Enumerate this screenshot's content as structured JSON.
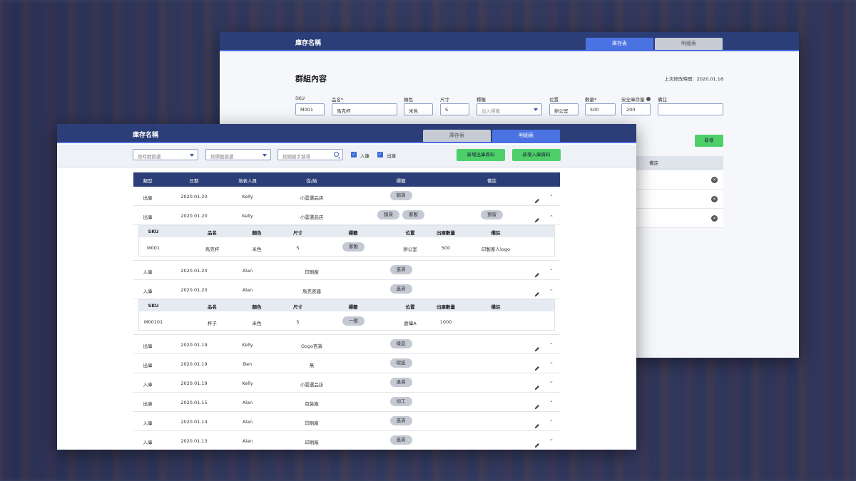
{
  "back_window": {
    "title": "庫存名稱",
    "tabs": [
      {
        "label": "庫存表",
        "active": true
      },
      {
        "label": "明細表",
        "active": false
      }
    ],
    "group_title": "群組內容",
    "last_modified": "上次修改時間：2020.01.18",
    "fields": {
      "sku": {
        "label": "SKU",
        "value": "M001"
      },
      "name": {
        "label": "品名*",
        "value": "馬克杯"
      },
      "color": {
        "label": "顏色",
        "value": "米色"
      },
      "size": {
        "label": "尺寸",
        "value": "S"
      },
      "tag": {
        "label": "標籤",
        "placeholder": "加入標籤"
      },
      "location": {
        "label": "位置",
        "value": "辦公室"
      },
      "quantity": {
        "label": "數量*",
        "value": "500"
      },
      "safety_stock": {
        "label": "安全庫存量",
        "value": "200"
      },
      "note": {
        "label": "備註",
        "value": ""
      }
    },
    "add_button": "新增",
    "mini_table_header": "備註"
  },
  "front_window": {
    "title": "庫存名稱",
    "tabs": [
      {
        "label": "庫存表",
        "active": false
      },
      {
        "label": "明細表",
        "active": true
      }
    ],
    "filters": {
      "time": "按時間篩選",
      "tag": "按標籤篩選",
      "keyword": "按關鍵字搜尋",
      "in_label": "入庫",
      "out_label": "出庫"
    },
    "buttons": {
      "add_out": "新增出庫資料",
      "add_in": "新增入庫資料"
    },
    "columns": [
      "類型",
      "日期",
      "填表人員",
      "從/給",
      "標籤",
      "備註"
    ],
    "detail_columns": [
      "SKU",
      "品名",
      "顏色",
      "尺寸",
      "標籤",
      "位置",
      "出庫數量",
      "備註"
    ],
    "rows": [
      {
        "type": "出庫",
        "date": "2020.01.20",
        "person": "Kelly",
        "party": "小雲選品店",
        "tags": [
          "銷貨"
        ],
        "note": "",
        "expanded": false
      },
      {
        "type": "出庫",
        "date": "2020.01.20",
        "person": "Kelly",
        "party": "小雲選品店",
        "tags": [
          "銷貨",
          "客製"
        ],
        "note": "預留",
        "expanded": true,
        "detail": {
          "sku": "M001",
          "name": "馬克杯",
          "color": "米色",
          "size": "S",
          "tag": "客製",
          "location": "辦公室",
          "qty": "500",
          "note": "印製客人logo"
        }
      },
      {
        "type": "入庫",
        "date": "2020.01.20",
        "person": "Alan",
        "party": "印刷廠",
        "tags": [
          "進貨"
        ],
        "note": "",
        "expanded": false
      },
      {
        "type": "入庫",
        "date": "2020.01.20",
        "person": "Alan",
        "party": "馬克瓷器",
        "tags": [
          "進貨"
        ],
        "note": "",
        "expanded": true,
        "detail": {
          "sku": "M00101",
          "name": "杯子",
          "color": "米色",
          "size": "S",
          "tag": "一般",
          "location": "倉庫A",
          "qty": "1000",
          "note": ""
        }
      },
      {
        "type": "出庫",
        "date": "2020.01.19",
        "person": "Kelly",
        "party": "Gogo百貨",
        "tags": [
          "樣品"
        ],
        "note": "",
        "expanded": false
      },
      {
        "type": "出庫",
        "date": "2020.01.19",
        "person": "Ben",
        "party": "無",
        "tags": [
          "瑕疵"
        ],
        "note": "",
        "expanded": false
      },
      {
        "type": "入庫",
        "date": "2020.01.19",
        "person": "Kelly",
        "party": "小雲選品店",
        "tags": [
          "退貨"
        ],
        "note": "",
        "expanded": false
      },
      {
        "type": "出庫",
        "date": "2020.01.15",
        "person": "Alan",
        "party": "包裝廠",
        "tags": [
          "加工"
        ],
        "note": "",
        "expanded": false
      },
      {
        "type": "入庫",
        "date": "2020.01.14",
        "person": "Alan",
        "party": "印刷廠",
        "tags": [
          "進貨"
        ],
        "note": "",
        "expanded": false
      },
      {
        "type": "入庫",
        "date": "2020.01.13",
        "person": "Alan",
        "party": "印刷廠",
        "tags": [
          "進貨"
        ],
        "note": "",
        "expanded": false
      }
    ]
  }
}
